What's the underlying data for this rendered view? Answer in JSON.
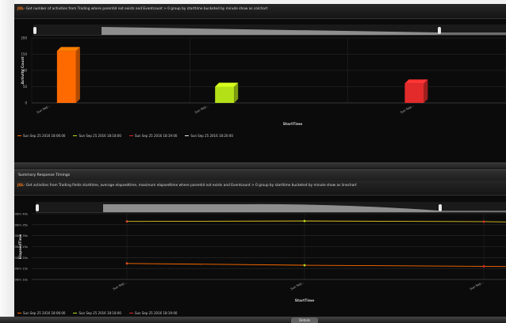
{
  "top_panel": {
    "query_prefix": "JQL",
    "query_text": "- Get number of activities from Trading where parentid not exists and Eventcount > 0 group by starttime bucketed by minute show as colchart",
    "chart_data": {
      "type": "bar",
      "categories": [
        "Sun Sep...",
        "Sun Sep...",
        "Sun Sep..."
      ],
      "values": [
        160,
        50,
        60
      ],
      "colors": [
        "#ff6a00",
        "#b4e017",
        "#e32b2b"
      ],
      "ylim": [
        0,
        200
      ],
      "y_ticks": [
        "200",
        "150",
        "100",
        "50",
        "0"
      ],
      "ylabel": "Activity Count",
      "xlabel": "StartTime",
      "grid": true
    },
    "legend": [
      {
        "label": "Sun Sep 25 2016 18:06:00",
        "color": "#ff6a00"
      },
      {
        "label": "Sun Sep 25 2016 18:18:00",
        "color": "#b4e017"
      },
      {
        "label": "Sun Sep 25 2016 18:19:00",
        "color": "#e32b2b"
      },
      {
        "label": "Sun Sep 25 2016 18:20:00",
        "color": "#e8e8e8"
      }
    ]
  },
  "summary_panel": {
    "title": "Summary Response Timings"
  },
  "bottom_panel": {
    "query_prefix": "JQL",
    "query_text": "- Get activities from Trading fields starttime, average elapsedtime, maximum elapsedtime where parentid not exists and Eventcount > 0 group by starttime bucketed by minute show as linechart",
    "chart_data": {
      "type": "line",
      "categories": [
        "Sun Sep...",
        "Sun Sep...",
        "Sun Sep..."
      ],
      "y_ticks": [
        "00m 40s",
        "00m 35s",
        "00m 30s",
        "00m 25s",
        "00m 20s",
        "00m 15s",
        "00m 10s"
      ],
      "ylim": [
        10,
        40
      ],
      "ylabel": "ElapsedTime",
      "xlabel": "StartTime",
      "grid": true,
      "series": [
        {
          "values": [
            36.5,
            36.7,
            36.4
          ],
          "color": "#e3c520"
        },
        {
          "values": [
            17.3,
            16.5,
            16.0
          ],
          "color": "#ff6a00"
        }
      ],
      "point_colors": [
        [
          "#e34a2b",
          "#b4e017",
          "#e32b2b"
        ],
        [
          "#e34a2b",
          "#b4e017",
          "#e32b2b"
        ]
      ]
    },
    "legend": [
      {
        "label": "Sun Sep 25 2016 18:06:00",
        "color": "#ff6a00"
      },
      {
        "label": "Sun Sep 25 2016 18:18:00",
        "color": "#b4e017"
      },
      {
        "label": "Sun Sep 25 2016 18:19:00",
        "color": "#e32b2b"
      }
    ]
  },
  "footer": {
    "details_label": "Details"
  }
}
